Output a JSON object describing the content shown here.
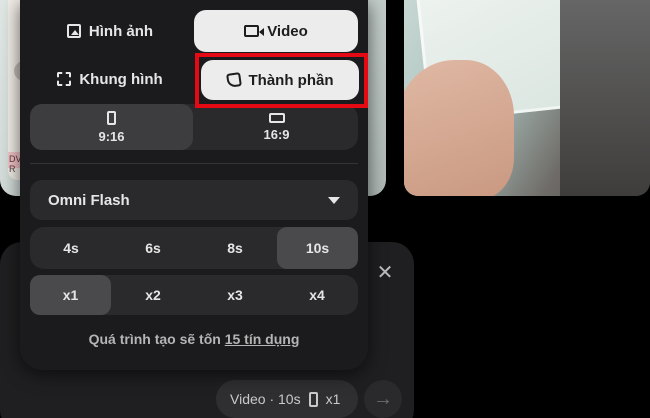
{
  "thumbnails": {
    "left_badge": "DV R"
  },
  "popup": {
    "modes": [
      {
        "label": "Hình ảnh",
        "icon": "image-icon",
        "selected": false
      },
      {
        "label": "Video",
        "icon": "video-icon",
        "selected": true
      },
      {
        "label": "Khung hình",
        "icon": "frame-icon",
        "selected": false
      },
      {
        "label": "Thành phần",
        "icon": "component-icon",
        "selected": false
      }
    ],
    "aspect_ratios": [
      {
        "label": "9:16",
        "icon": "portrait-icon",
        "selected": true
      },
      {
        "label": "16:9",
        "icon": "landscape-icon",
        "selected": false
      }
    ],
    "model": {
      "label": "Omni Flash"
    },
    "durations": [
      {
        "label": "4s",
        "selected": false
      },
      {
        "label": "6s",
        "selected": false
      },
      {
        "label": "8s",
        "selected": false
      },
      {
        "label": "10s",
        "selected": true
      }
    ],
    "counts": [
      {
        "label": "x1",
        "selected": true
      },
      {
        "label": "x2",
        "selected": false
      },
      {
        "label": "x3",
        "selected": false
      },
      {
        "label": "x4",
        "selected": false
      }
    ],
    "credits": {
      "prefix": "Quá trình tạo sẽ tốn",
      "link": "15 tín dụng"
    }
  },
  "prompt_bar": {
    "close_icon": "✕",
    "config_chip": {
      "type": "Video · 10s",
      "count": "x1"
    },
    "send_icon": "→"
  },
  "colors": {
    "highlight": "#e50914",
    "selected_segment": "#ececec"
  }
}
